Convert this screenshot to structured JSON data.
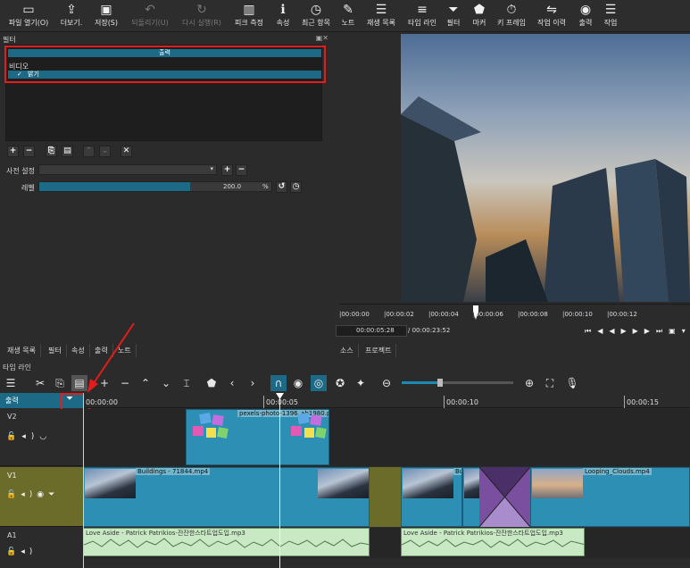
{
  "toolbar": {
    "items": [
      {
        "icon": "folder-open-icon",
        "label": "파일 열기(O)",
        "enabled": true
      },
      {
        "icon": "export-more-icon",
        "label": "더보기.",
        "enabled": true
      },
      {
        "icon": "save-icon",
        "label": "저장(S)",
        "enabled": true
      },
      {
        "icon": "undo-icon",
        "label": "되돌리기(U)",
        "enabled": false
      },
      {
        "icon": "redo-icon",
        "label": "다시 실행(R)",
        "enabled": false
      },
      {
        "icon": "peak-meter-icon",
        "label": "피크 측정",
        "enabled": true
      },
      {
        "icon": "info-icon",
        "label": "속성",
        "enabled": true
      },
      {
        "icon": "clock-icon",
        "label": "최근 항목",
        "enabled": true
      },
      {
        "icon": "note-icon",
        "label": "노트",
        "enabled": true
      },
      {
        "icon": "list-icon",
        "label": "재생 목록",
        "enabled": true
      },
      {
        "icon": "timeline-icon",
        "label": "타임 라인",
        "enabled": true
      },
      {
        "icon": "filter-icon",
        "label": "필터",
        "enabled": true
      },
      {
        "icon": "marker-icon",
        "label": "마커",
        "enabled": true
      },
      {
        "icon": "stopwatch-icon",
        "label": "키 프레임",
        "enabled": true
      },
      {
        "icon": "history-icon",
        "label": "작업 이력",
        "enabled": true
      },
      {
        "icon": "export-icon",
        "label": "출력",
        "enabled": true
      },
      {
        "icon": "jobs-icon",
        "label": "작업",
        "enabled": true
      }
    ]
  },
  "filters_panel": {
    "title": "필터",
    "output_header": "출력",
    "category": "비디오",
    "item_check": "✓",
    "item_label": "밝기",
    "preset_label": "사전 설정",
    "level_label": "레벨",
    "level_value": "200.0",
    "level_unit": "%",
    "level_fraction": 0.65
  },
  "player": {
    "ruler_labels": [
      "|00:00:00",
      "|00:00:02",
      "|00:00:04",
      "|00:00:06",
      "|00:00:08",
      "|00:00:10",
      "|00:00:12"
    ],
    "current_time": "00:00:05:28",
    "total_time": "/ 00:00:23:52"
  },
  "left_tabs": [
    "재생 목록",
    "필터",
    "속성",
    "출력",
    "노트"
  ],
  "right_tabs": [
    "소스",
    "프로젝트"
  ],
  "timeline": {
    "title": "타임 라인",
    "ruler_labels": [
      "00:00:00",
      "00:00:05",
      "00:00:10",
      "00:00:15"
    ],
    "output_track": "출력",
    "tracks": [
      {
        "name": "V2"
      },
      {
        "name": "V1"
      },
      {
        "name": "A1"
      }
    ],
    "clips": {
      "v2_clip": "pexels-photo-1396_ab1980.png",
      "v1_clip1": "Buildings - 71844.mp4",
      "v1_clip2": "Bu",
      "v1_clip3": "Looping_Clouds.mp4",
      "a1_clip1": "Love Aside - Patrick Patrikios-잔잔한스타트업도입.mp3",
      "a1_clip2": "Love Aside - Patrick Patrikios-잔잔한스타트업도입.mp3"
    }
  }
}
